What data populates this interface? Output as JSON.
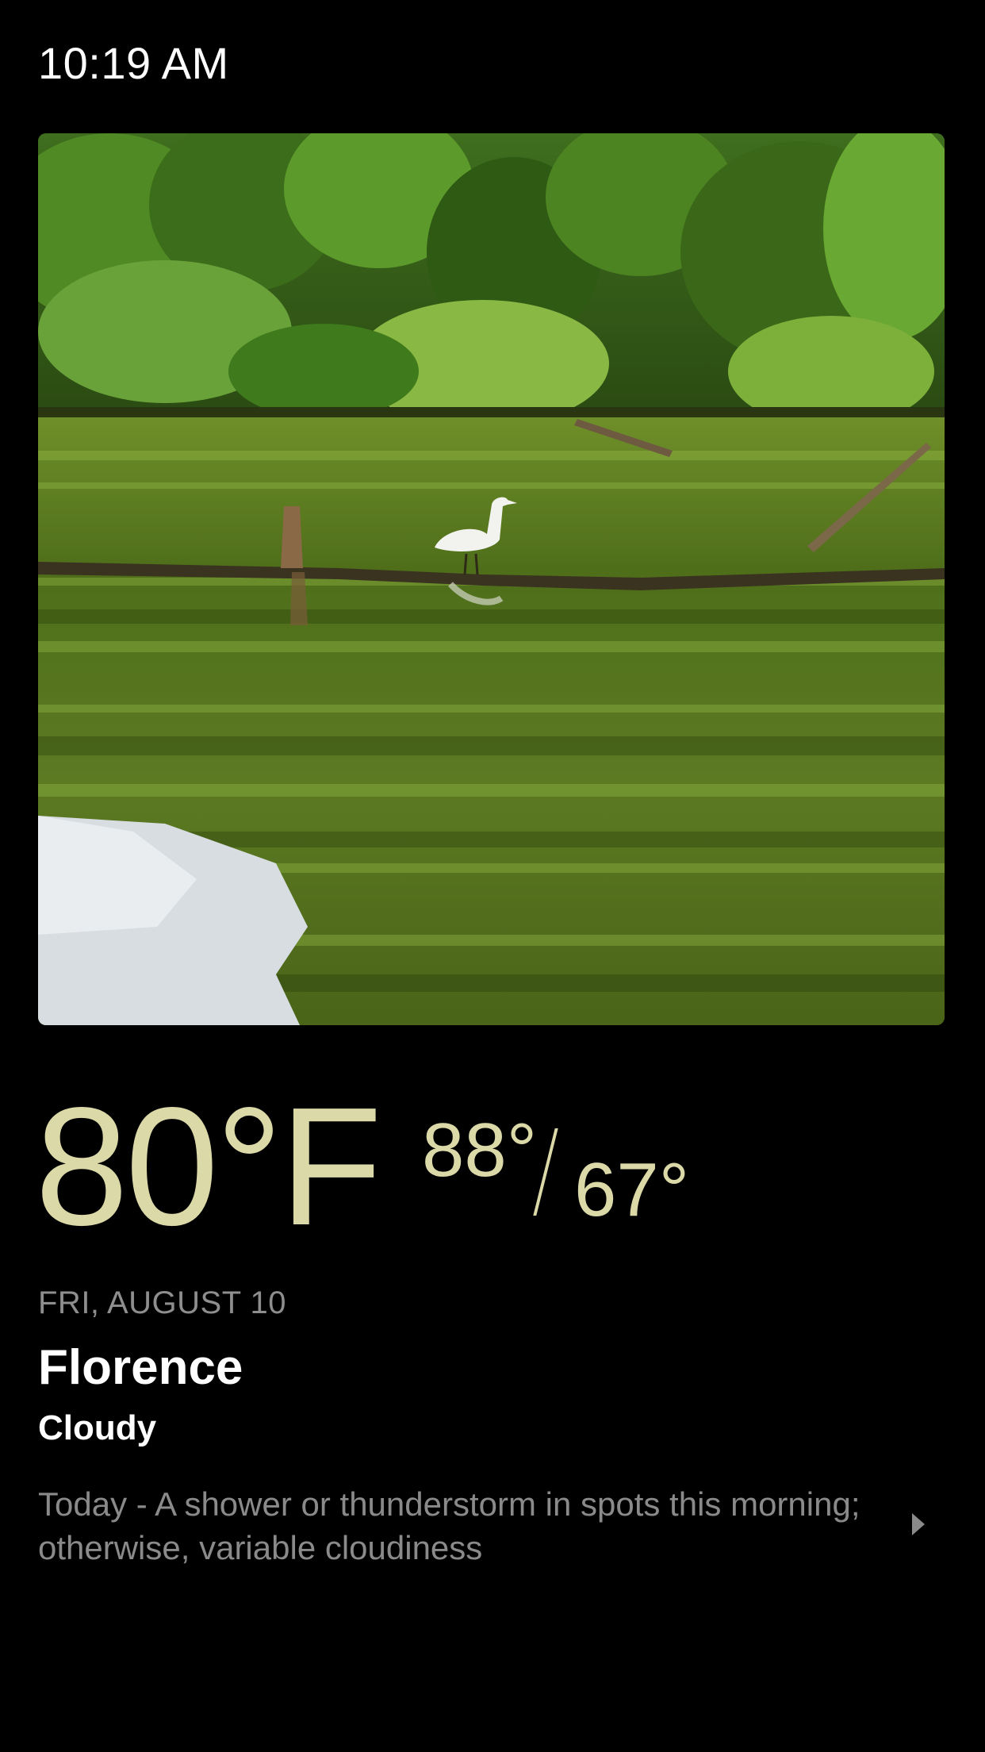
{
  "status_bar": {
    "time": "10:19 AM"
  },
  "photo": {
    "subject": "heron on a log in a green pond with tree reflections"
  },
  "weather": {
    "current_temp": "80°F",
    "high": "88°",
    "low": "67°",
    "date": "FRI, AUGUST 10",
    "city": "Florence",
    "condition": "Cloudy",
    "forecast": "Today - A shower or thunderstorm in spots this morning; otherwise, variable cloudiness"
  },
  "icons": {
    "more": "chevron-right-icon"
  },
  "colors": {
    "background": "#000000",
    "temperature": "#dcd9a8",
    "secondary_text": "#8e8e8e",
    "primary_text": "#ffffff"
  }
}
